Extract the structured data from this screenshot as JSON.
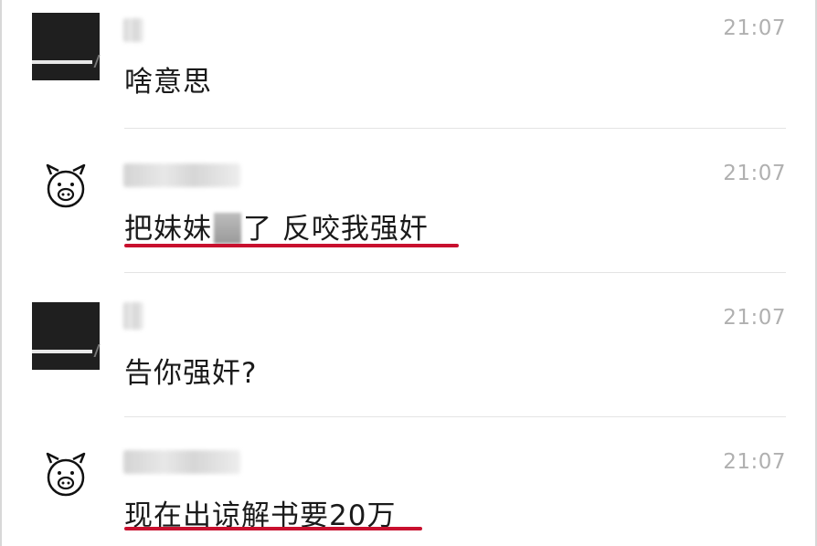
{
  "messages": [
    {
      "sender": "",
      "time": "21:07",
      "text": "啥意思",
      "avatar": "dark-photo-avatar",
      "highlighted": false
    },
    {
      "sender": "",
      "time": "21:07",
      "text_before": "把妹妹",
      "text_after": "了 反咬我强奸",
      "avatar": "pig-face-avatar",
      "highlighted": true
    },
    {
      "sender": "",
      "time": "21:07",
      "text": "告你强奸?",
      "avatar": "dark-photo-avatar",
      "highlighted": false
    },
    {
      "sender": "",
      "time": "21:07",
      "text": "现在出谅解书要20万",
      "avatar": "pig-face-avatar",
      "highlighted": true
    }
  ],
  "colors": {
    "underline": "#c8102e",
    "time": "#b0b0b0",
    "message_text": "#1a1a1a",
    "divider": "#e4e4e4"
  }
}
